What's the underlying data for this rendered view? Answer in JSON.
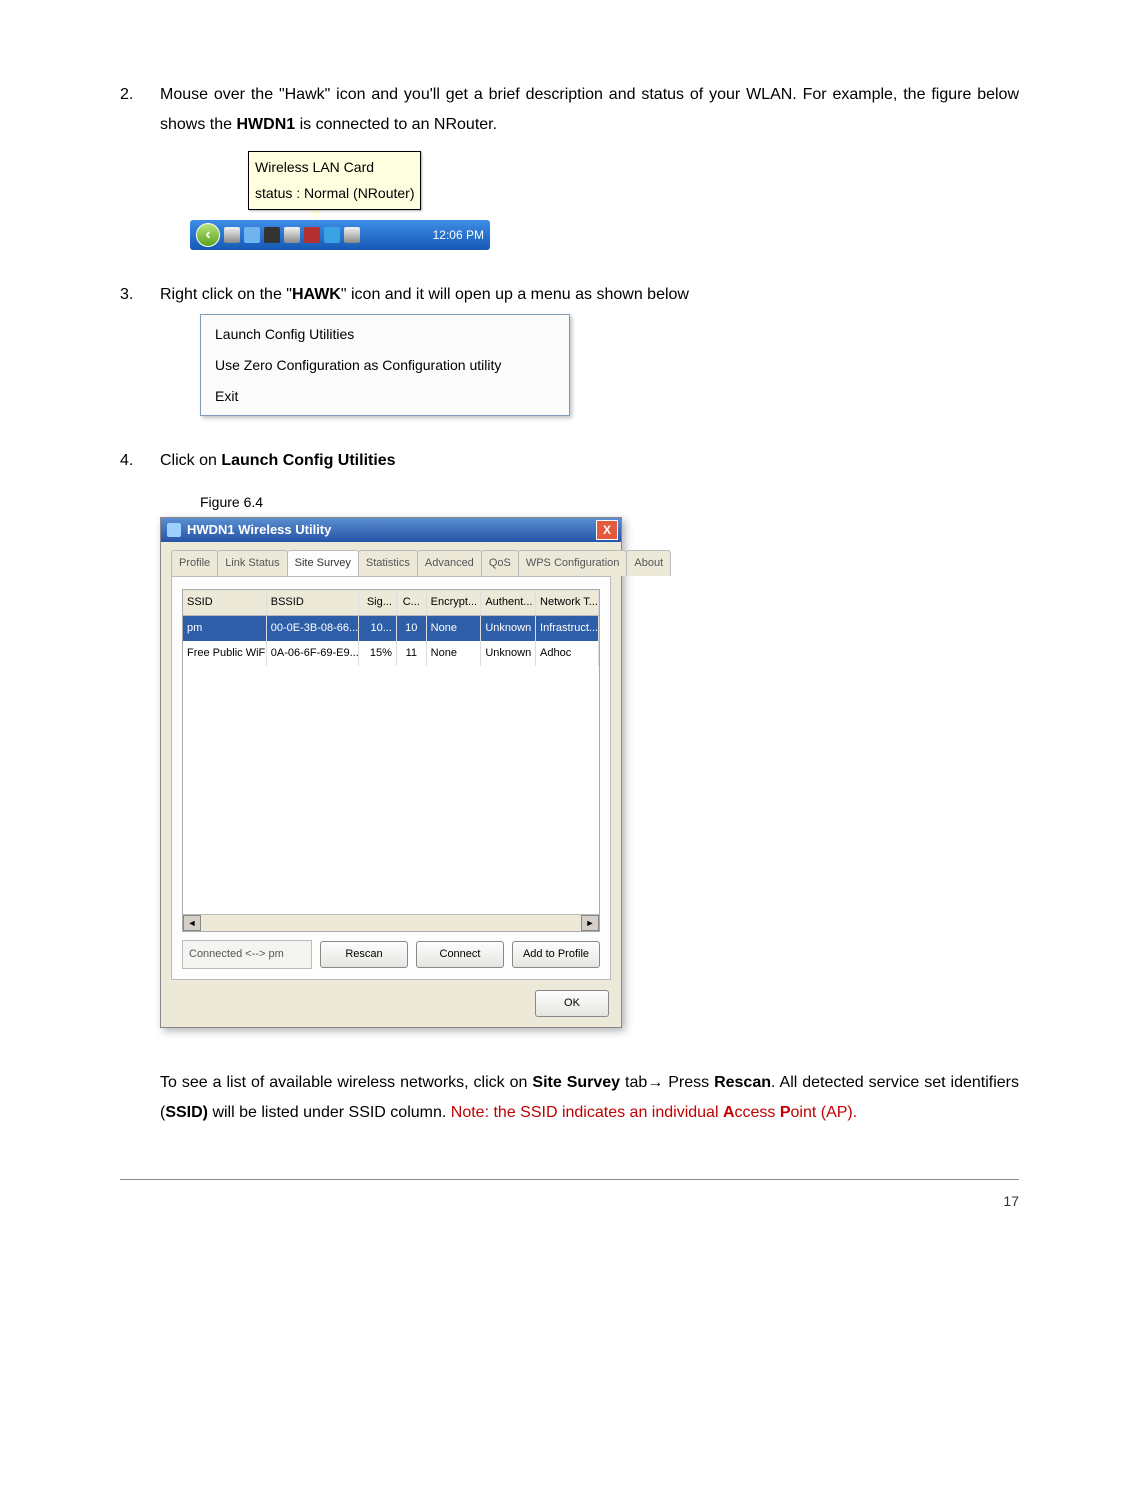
{
  "steps": {
    "s2": {
      "num": "2.",
      "text_a": "Mouse over the \"Hawk\" icon and you'll get a brief description and status of your WLAN.  For example, the figure below shows the ",
      "bold_a": "HWDN1",
      "text_b": " is connected to an NRouter."
    },
    "s3": {
      "num": "3.",
      "text_a": "Right click on the \"",
      "bold_a": "HAWK",
      "text_b": "\" icon and it will open up a menu as shown below"
    },
    "s4": {
      "num": "4.",
      "text_a": "Click on ",
      "bold_a": "Launch Config Utilities"
    }
  },
  "fig1": {
    "tooltip_line1": "Wireless LAN Card",
    "tooltip_line2": "status : Normal (NRouter)",
    "clock": "12:06 PM",
    "start_glyph": "‹"
  },
  "context_menu": {
    "item1": "Launch Config Utilities",
    "item2": "Use Zero Configuration as Configuration utility",
    "item3": "Exit"
  },
  "figure_label": "Figure 6.4",
  "win": {
    "title": "HWDN1 Wireless Utility",
    "close": "X",
    "tabs": {
      "t1": "Profile",
      "t2": "Link Status",
      "t3": "Site Survey",
      "t4": "Statistics",
      "t5": "Advanced",
      "t6": "QoS",
      "t7": "WPS Configuration",
      "t8": "About"
    },
    "columns": {
      "ssid": "SSID",
      "bssid": "BSSID",
      "sig": "Sig...",
      "ch": "C...",
      "enc": "Encrypt...",
      "auth": "Authent...",
      "net": "Network T..."
    },
    "rows": [
      {
        "ssid": "pm",
        "bssid": "00-0E-3B-08-66...",
        "sig": "10...",
        "ch": "10",
        "enc": "None",
        "auth": "Unknown",
        "net": "Infrastruct..."
      },
      {
        "ssid": "Free Public WiFi",
        "bssid": "0A-06-6F-69-E9...",
        "sig": "15%",
        "ch": "11",
        "enc": "None",
        "auth": "Unknown",
        "net": "Adhoc"
      }
    ],
    "status": "Connected <--> pm",
    "btn_rescan": "Rescan",
    "btn_connect": "Connect",
    "btn_addprofile": "Add to Profile",
    "btn_ok": "OK",
    "scroll_left": "◄",
    "scroll_right": "►"
  },
  "para": {
    "a": "To see a list of available wireless networks, click on ",
    "b_bold": "Site Survey",
    "c": " tab",
    "arrow": "→",
    "d": " Press ",
    "e_bold": "Rescan",
    "f": ".   All detected service set identifiers (",
    "g_bold": "SSID)",
    "h": " will be listed under SSID column.   ",
    "note_a": "Note: the SSID indicates an individual ",
    "note_b": "A",
    "note_c": "ccess ",
    "note_d": "P",
    "note_e": "oint (AP)."
  },
  "page_number": "17"
}
